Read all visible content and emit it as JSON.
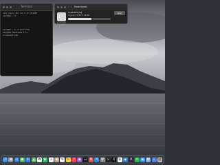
{
  "terminal": {
    "title": "Terminal",
    "lines": [
      "Last login: Mon Jun 3 on ttys000",
      "user@Mac ~ %",
      "",
      "user@Mac ~ % cd Downloads",
      "user@Mac Downloads % ls",
      "screenshot.png"
    ]
  },
  "info_window": {
    "back_label": "‹",
    "forward_label": "›",
    "title": "Downloads",
    "file_name": "Screenshot.png",
    "file_meta": "Copying 1.2 MB of 4.8 MB",
    "progress": 0.55,
    "action_button": "Stop",
    "footer": "1 of 1 item"
  },
  "dock": {
    "apps": [
      {
        "name": "finder",
        "color": "#2f8ee8",
        "glyph": "☺"
      },
      {
        "name": "launchpad",
        "color": "#8a8f99",
        "glyph": "▦"
      },
      {
        "name": "safari",
        "color": "#1e7fe0",
        "glyph": "◎"
      },
      {
        "name": "messages",
        "color": "#34c759",
        "glyph": "●"
      },
      {
        "name": "mail",
        "color": "#2a84ff",
        "glyph": "✉"
      },
      {
        "name": "maps",
        "color": "#5bb35e",
        "glyph": "▲"
      },
      {
        "name": "photos",
        "color": "#f2f2f2",
        "glyph": "✿"
      },
      {
        "name": "facetime",
        "color": "#30c25a",
        "glyph": "▶"
      },
      {
        "name": "calendar",
        "color": "#ffffff",
        "glyph": "3"
      },
      {
        "name": "contacts",
        "color": "#c9a47a",
        "glyph": "◉"
      },
      {
        "name": "reminders",
        "color": "#f5f5f5",
        "glyph": "≡"
      },
      {
        "name": "notes",
        "color": "#f7d046",
        "glyph": "✎"
      },
      {
        "name": "music",
        "color": "#fa3f57",
        "glyph": "♪"
      },
      {
        "name": "podcasts",
        "color": "#9b59d0",
        "glyph": "◉"
      },
      {
        "name": "tv",
        "color": "#1c1c1c",
        "glyph": "▭"
      },
      {
        "name": "news",
        "color": "#f04b4b",
        "glyph": "N"
      },
      {
        "name": "app-store",
        "color": "#1f8bf2",
        "glyph": "A"
      },
      {
        "name": "settings",
        "color": "#8e8e93",
        "glyph": "⚙"
      },
      {
        "name": "terminal",
        "color": "#222222",
        "glyph": ">"
      },
      {
        "name": "x",
        "color": "#111111",
        "glyph": "X"
      },
      {
        "name": "chrome",
        "color": "#ffffff",
        "glyph": "◍"
      },
      {
        "name": "vs-code",
        "color": "#1e88d8",
        "glyph": "◆"
      },
      {
        "name": "slack",
        "color": "#4a154b",
        "glyph": "#"
      },
      {
        "name": "spotify",
        "color": "#1db954",
        "glyph": "≋"
      },
      {
        "name": "zoom",
        "color": "#2d8cff",
        "glyph": "▣"
      },
      {
        "name": "preview",
        "color": "#7aa7d9",
        "glyph": "▤"
      },
      {
        "name": "downloads-stack",
        "color": "#3b82f6",
        "glyph": "↓"
      },
      {
        "name": "trash",
        "color": "#b8bcc2",
        "glyph": "▥"
      }
    ]
  }
}
